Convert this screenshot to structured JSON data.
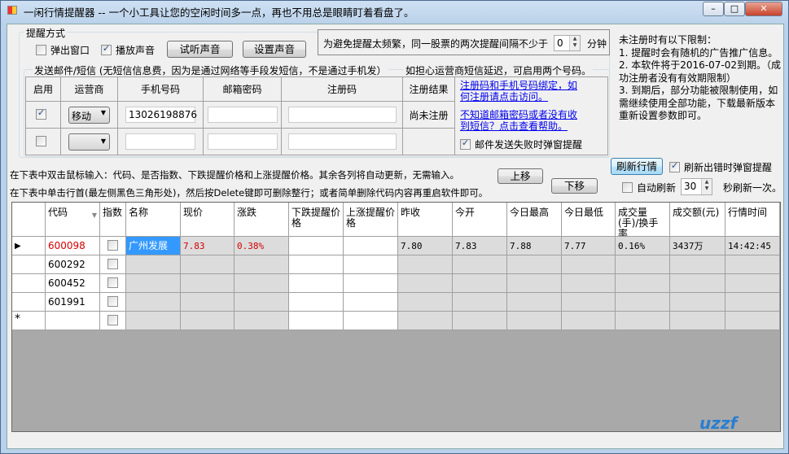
{
  "window": {
    "title": "一闲行情提醒器 -- 一个小工具让您的空闲时间多一点，再也不用总是眼睛盯着看盘了。"
  },
  "alert_mode": {
    "legend": "提醒方式",
    "popup_label": "弹出窗口",
    "popup_checked": false,
    "sound_label": "播放声音",
    "sound_checked": true,
    "preview_sound": "试听声音",
    "set_sound": "设置声音"
  },
  "interval": {
    "label": "为避免提醒太频繁，同一股票的两次提醒间隔不少于",
    "value": "0",
    "unit": "分钟"
  },
  "sms": {
    "legend": "发送邮件/短信 (无短信信息费，因为是通过网络等手段发短信，不是通过手机发）",
    "legend2": "如担心运营商短信延迟，可启用两个号码。",
    "headers": [
      "启用",
      "运营商",
      "手机号码",
      "邮箱密码",
      "注册码",
      "注册结果"
    ],
    "rows": [
      {
        "enabled": true,
        "carrier": "移动",
        "phone": "13026198876",
        "email_pwd": "",
        "reg_code": "",
        "result": "尚未注册"
      },
      {
        "enabled": false,
        "carrier": "",
        "phone": "",
        "email_pwd": "",
        "reg_code": "",
        "result": ""
      }
    ],
    "link1": "注册码和手机号码绑定，如何注册请点击访问。",
    "link2": "不知道邮箱密码或者没有收到短信？点击查看帮助。",
    "fail_popup_label": "邮件发送失败时弹窗提醒",
    "fail_popup_checked": true
  },
  "notice": {
    "title": "未注册时有以下限制：",
    "lines": [
      "1. 提醒时会有随机的广告推广信息。",
      "2. 本软件将于2016-07-02到期。（成功注册者没有有效期限制）",
      "3. 到期后，部分功能被限制使用，如需继续使用全部功能，下载最新版本重新设置参数即可。"
    ]
  },
  "instructions": {
    "line1": "在下表中双击鼠标输入：代码、是否指数、下跌提醒价格和上涨提醒价格。其余各列将自动更新，无需输入。",
    "line2": "在下表中单击行首(最左侧黑色三角形处)，然后按Delete键即可删除整行；或者简单删除代码内容再重启软件即可。"
  },
  "buttons": {
    "up": "上移",
    "down": "下移",
    "refresh": "刷新行情"
  },
  "refresh": {
    "error_popup_label": "刷新出错时弹窗提醒",
    "error_popup_checked": true,
    "auto_label": "自动刷新",
    "auto_checked": false,
    "seconds": "30",
    "suffix": "秒刷新一次。"
  },
  "grid": {
    "columns": [
      "代码",
      "指数",
      "名称",
      "现价",
      "涨跌",
      "下跌提醒价格",
      "上涨提醒价格",
      "昨收",
      "今开",
      "今日最高",
      "今日最低",
      "成交量(手)/换手率",
      "成交额(元)",
      "行情时间"
    ],
    "rows": [
      [
        "600098",
        false,
        "广州发展",
        "7.83",
        "0.38%",
        "",
        "",
        "7.80",
        "7.83",
        "7.88",
        "7.77",
        "0.16%",
        "3437万",
        "14:42:45"
      ],
      [
        "600292",
        false,
        "",
        "",
        "",
        "",
        "",
        "",
        "",
        "",
        "",
        "",
        "",
        ""
      ],
      [
        "600452",
        false,
        "",
        "",
        "",
        "",
        "",
        "",
        "",
        "",
        "",
        "",
        "",
        ""
      ],
      [
        "601991",
        false,
        "",
        "",
        "",
        "",
        "",
        "",
        "",
        "",
        "",
        "",
        "",
        ""
      ],
      [
        "",
        false,
        "",
        "",
        "",
        "",
        "",
        "",
        "",
        "",
        "",
        "",
        "",
        ""
      ]
    ],
    "current_marker": "▶",
    "new_row_marker": "*"
  },
  "watermark": "uzzf.com",
  "colors": {
    "up": "#d40000",
    "selected": "#3399ff"
  }
}
